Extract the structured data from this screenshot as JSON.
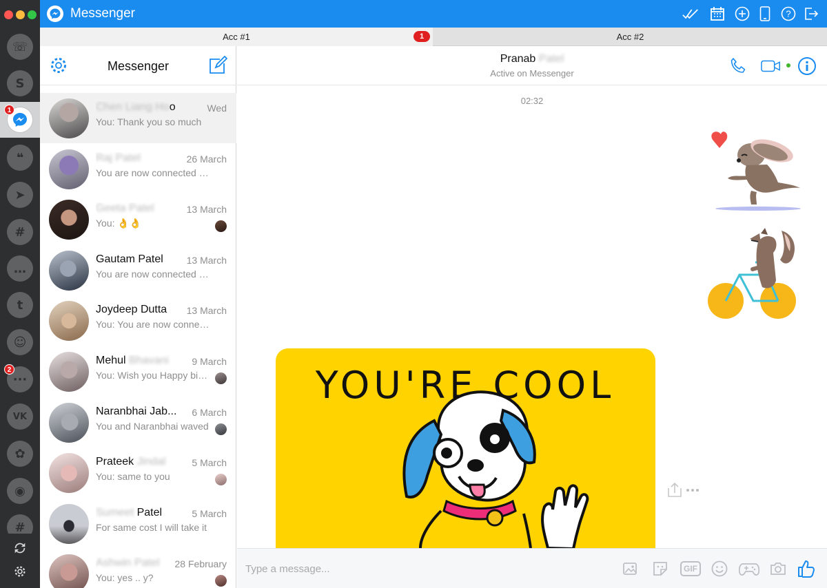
{
  "window": {
    "title": "Messenger"
  },
  "colors": {
    "accent": "#1a8cf0",
    "rail": "#2e2f31",
    "badge": "#e02020",
    "sticker_bg": "#fed300"
  },
  "services": [
    {
      "name": "whatsapp",
      "glyph": "☏",
      "badge": ""
    },
    {
      "name": "skype",
      "glyph": "S",
      "badge": ""
    },
    {
      "name": "messenger",
      "glyph": "",
      "badge": "1"
    },
    {
      "name": "hangouts",
      "glyph": "❝",
      "badge": ""
    },
    {
      "name": "telegram",
      "glyph": "➤",
      "badge": ""
    },
    {
      "name": "slack",
      "glyph": "#",
      "badge": ""
    },
    {
      "name": "chat",
      "glyph": "…",
      "badge": ""
    },
    {
      "name": "twitter",
      "glyph": "t",
      "badge": ""
    },
    {
      "name": "smile-app",
      "glyph": "☺",
      "badge": ""
    },
    {
      "name": "sms",
      "glyph": "···",
      "badge": "2"
    },
    {
      "name": "vk",
      "glyph": "VK",
      "badge": ""
    },
    {
      "name": "icq",
      "glyph": "✿",
      "badge": ""
    },
    {
      "name": "discord",
      "glyph": "◉",
      "badge": ""
    },
    {
      "name": "more",
      "glyph": "#",
      "badge": ""
    }
  ],
  "tabs": [
    {
      "label": "Acc #1",
      "badge": "1"
    },
    {
      "label": "Acc #2",
      "badge": ""
    }
  ],
  "list": {
    "title": "Messenger"
  },
  "conversations": [
    {
      "name_a": "Chen Liang Ho",
      "name_b": "o",
      "date": "Wed",
      "snippet": "You: Thank you so much",
      "seen": false
    },
    {
      "name_a": "Raj Patel",
      "name_b": "",
      "date": "26 March",
      "snippet": "You are now connected on Messenger",
      "seen": false
    },
    {
      "name_a": "Geeta Patel",
      "name_b": "",
      "date": "13 March",
      "snippet": "You: 👌👌",
      "seen": true
    },
    {
      "name_a": "",
      "name_b": "Gautam Patel",
      "date": "13 March",
      "snippet": "You are now connected on Messenger",
      "seen": false
    },
    {
      "name_a": "",
      "name_b": "Joydeep Dutta",
      "date": "13 March",
      "snippet": "You: You are now connected",
      "seen": false
    },
    {
      "name_a": "Mehul",
      "name_b": "Bhavani",
      "date": "9 March",
      "snippet": "You: Wish you Happy birthday",
      "seen": true
    },
    {
      "name_a": "",
      "name_b": "Naranbhai Jab...",
      "date": "6 March",
      "snippet": "You and Naranbhai waved",
      "seen": true
    },
    {
      "name_a": "Prateek",
      "name_b": "Jindal",
      "date": "5 March",
      "snippet": "You: same to you",
      "seen": true
    },
    {
      "name_a": "Sumeet",
      "name_b": "Patel",
      "date": "5 March",
      "snippet": "For same cost I will take it",
      "seen": false
    },
    {
      "name_a": "Ashwin Patel",
      "name_b": "",
      "date": "28 February",
      "snippet": "You: yes .. y?",
      "seen": true
    }
  ],
  "chat": {
    "peer_first": "Pranab",
    "peer_last": "Patel",
    "status": "Active on Messenger",
    "timestamp": "02:32",
    "sticker_text": "YOU'RE COOL",
    "composer_placeholder": "Type a message...",
    "gif_label": "GIF"
  }
}
